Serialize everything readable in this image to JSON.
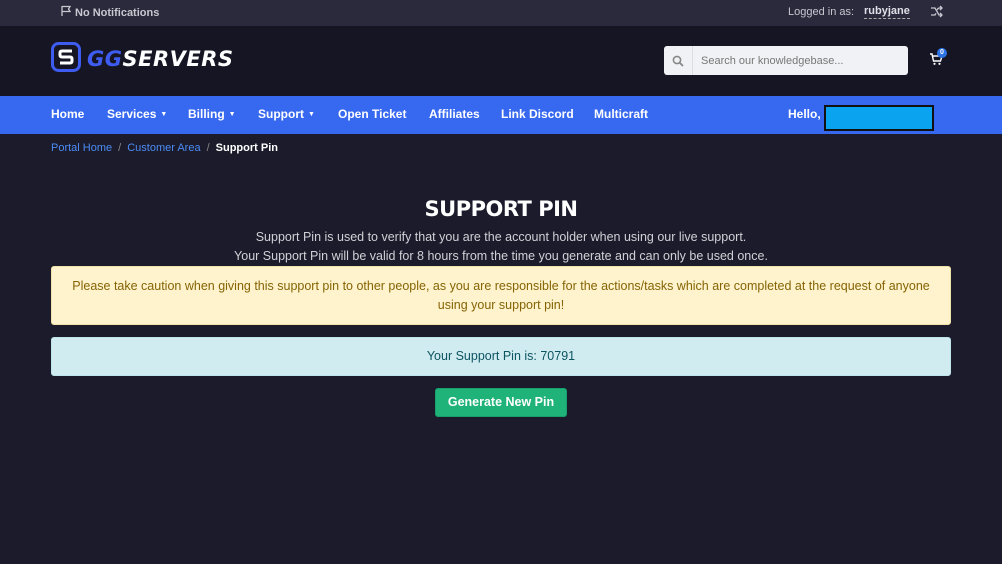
{
  "topbar": {
    "notifications": "No Notifications",
    "logged_in_label": "Logged in as:",
    "username": "rubyjane"
  },
  "header": {
    "logo": {
      "prefix": "GG",
      "suffix": "SERVERS"
    },
    "search_placeholder": "Search our knowledgebase...",
    "cart_count": "0"
  },
  "nav": {
    "items": [
      {
        "label": "Home",
        "dropdown": false
      },
      {
        "label": "Services",
        "dropdown": true
      },
      {
        "label": "Billing",
        "dropdown": true
      },
      {
        "label": "Support",
        "dropdown": true
      },
      {
        "label": "Open Ticket",
        "dropdown": false
      },
      {
        "label": "Affiliates",
        "dropdown": false
      },
      {
        "label": "Link Discord",
        "dropdown": false
      },
      {
        "label": "Multicraft",
        "dropdown": false
      }
    ],
    "hello": "Hello,"
  },
  "breadcrumb": {
    "items": [
      "Portal Home",
      "Customer Area"
    ],
    "current": "Support Pin"
  },
  "main": {
    "title": "SUPPORT PIN",
    "desc_line1": "Support Pin is used to verify that you are the account holder when using our live support.",
    "desc_line2": "Your Support Pin will be valid for 8 hours from the time you generate and can only be used once.",
    "warning": "Please take caution when giving this support pin to other people, as you are responsible for the actions/tasks which are completed at the request of anyone using your support pin!",
    "pin_text": "Your Support Pin is: 70791",
    "generate_button": "Generate New Pin"
  },
  "colors": {
    "nav": "#3768f0",
    "background": "#1b1b2b",
    "button": "#1fb37a",
    "warning_bg": "#fff3cd",
    "info_bg": "#d1ecf1"
  }
}
